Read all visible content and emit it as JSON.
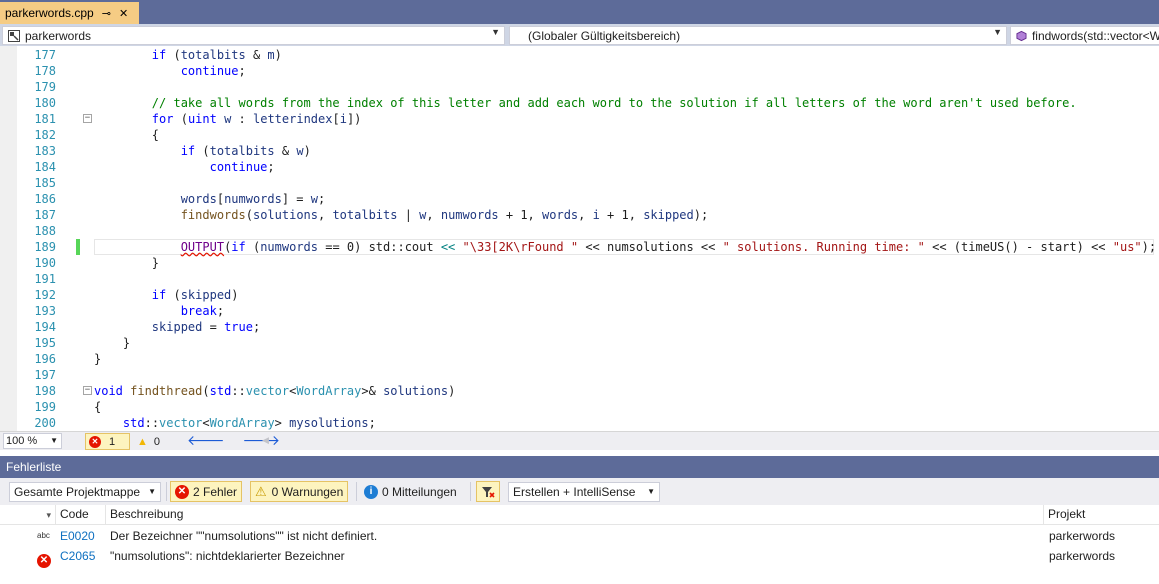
{
  "tab": {
    "filename": "parkerwords.cpp",
    "pin_glyph": "⊸",
    "close_glyph": "✕"
  },
  "navbar": {
    "project": "parkerwords",
    "scope": "(Globaler Gültigkeitsbereich)",
    "member": "findwords(std::vector<W"
  },
  "editor": {
    "lines": [
      {
        "num": "177",
        "html": "        <span class=\"kw\">if</span> (<span class=\"var\">totalbits</span> &amp; <span class=\"var\">m</span>)"
      },
      {
        "num": "178",
        "html": "            <span class=\"kw\">continue</span>;"
      },
      {
        "num": "179",
        "html": ""
      },
      {
        "num": "180",
        "html": "        <span class=\"cm\">// take all words from the index of this letter and add each word to the solution if all letters of the word aren't used before.</span>"
      },
      {
        "num": "181",
        "html": "        <span class=\"kw\">for</span> (<span class=\"kw\">uint</span> <span class=\"var\">w</span> : <span class=\"var\">letterindex</span>[<span class=\"var\">i</span>])"
      },
      {
        "num": "182",
        "html": "        {"
      },
      {
        "num": "183",
        "html": "            <span class=\"kw\">if</span> (<span class=\"var\">totalbits</span> &amp; <span class=\"var\">w</span>)"
      },
      {
        "num": "184",
        "html": "                <span class=\"kw\">continue</span>;"
      },
      {
        "num": "185",
        "html": ""
      },
      {
        "num": "186",
        "html": "            <span class=\"var\">words</span>[<span class=\"var\">numwords</span>] = <span class=\"var\">w</span>;"
      },
      {
        "num": "187",
        "html": "            <span class=\"fn\">findwords</span>(<span class=\"var\">solutions</span>, <span class=\"var\">totalbits</span> | <span class=\"var\">w</span>, <span class=\"var\">numwords</span> + 1, <span class=\"var\">words</span>, <span class=\"var\">i</span> + 1, <span class=\"var\">skipped</span>);"
      },
      {
        "num": "188",
        "html": ""
      },
      {
        "num": "189",
        "html": "            <span class=\"mac err\">OUTPUT</span>(<span class=\"kw\">if</span> (<span class=\"var\">numwords</span> == 0) std::cout <span class=\"op\">&lt;&lt;</span> <span class=\"str\">\"\\33[2K\\rFound \"</span> &lt;&lt; numsolutions &lt;&lt; <span class=\"str\">\" solutions. Running time: \"</span> &lt;&lt; (timeUS() - start) &lt;&lt; <span class=\"str\">\"us\"</span>);"
      },
      {
        "num": "190",
        "html": "        }"
      },
      {
        "num": "191",
        "html": ""
      },
      {
        "num": "192",
        "html": "        <span class=\"kw\">if</span> (<span class=\"var\">skipped</span>)"
      },
      {
        "num": "193",
        "html": "            <span class=\"kw\">break</span>;"
      },
      {
        "num": "194",
        "html": "        <span class=\"var\">skipped</span> = <span class=\"kw\">true</span>;"
      },
      {
        "num": "195",
        "html": "    }"
      },
      {
        "num": "196",
        "html": "}"
      },
      {
        "num": "197",
        "html": ""
      },
      {
        "num": "198",
        "html": "<span class=\"kw\">void</span> <span class=\"fn\">findthread</span>(<span class=\"kw\">std</span>::<span class=\"ty\">vector</span>&lt;<span class=\"ty\">WordArray</span>&gt;&amp; <span class=\"var\">solutions</span>)"
      },
      {
        "num": "199",
        "html": "{"
      },
      {
        "num": "200",
        "html": "    <span class=\"kw\">std</span>::<span class=\"ty\">vector</span>&lt;<span class=\"ty\">WordArray</span>&gt; <span class=\"var\">mysolutions</span>;"
      }
    ]
  },
  "status": {
    "zoom": "100 %",
    "errors": "1",
    "warnings": "0"
  },
  "errorlist": {
    "title": "Fehlerliste",
    "scope": "Gesamte Projektmappe",
    "errors_btn": "2 Fehler",
    "warnings_btn": "0 Warnungen",
    "messages_btn": "0 Mitteilungen",
    "build_filter": "Erstellen + IntelliSense",
    "columns": {
      "code": "Code",
      "desc": "Beschreibung",
      "project": "Projekt"
    },
    "rows": [
      {
        "code": "E0020",
        "desc": "Der Bezeichner \"\"numsolutions\"\" ist nicht definiert.",
        "project": "parkerwords"
      },
      {
        "code": "C2065",
        "desc": "\"numsolutions\": nichtdeklarierter Bezeichner",
        "project": "parkerwords"
      }
    ]
  }
}
